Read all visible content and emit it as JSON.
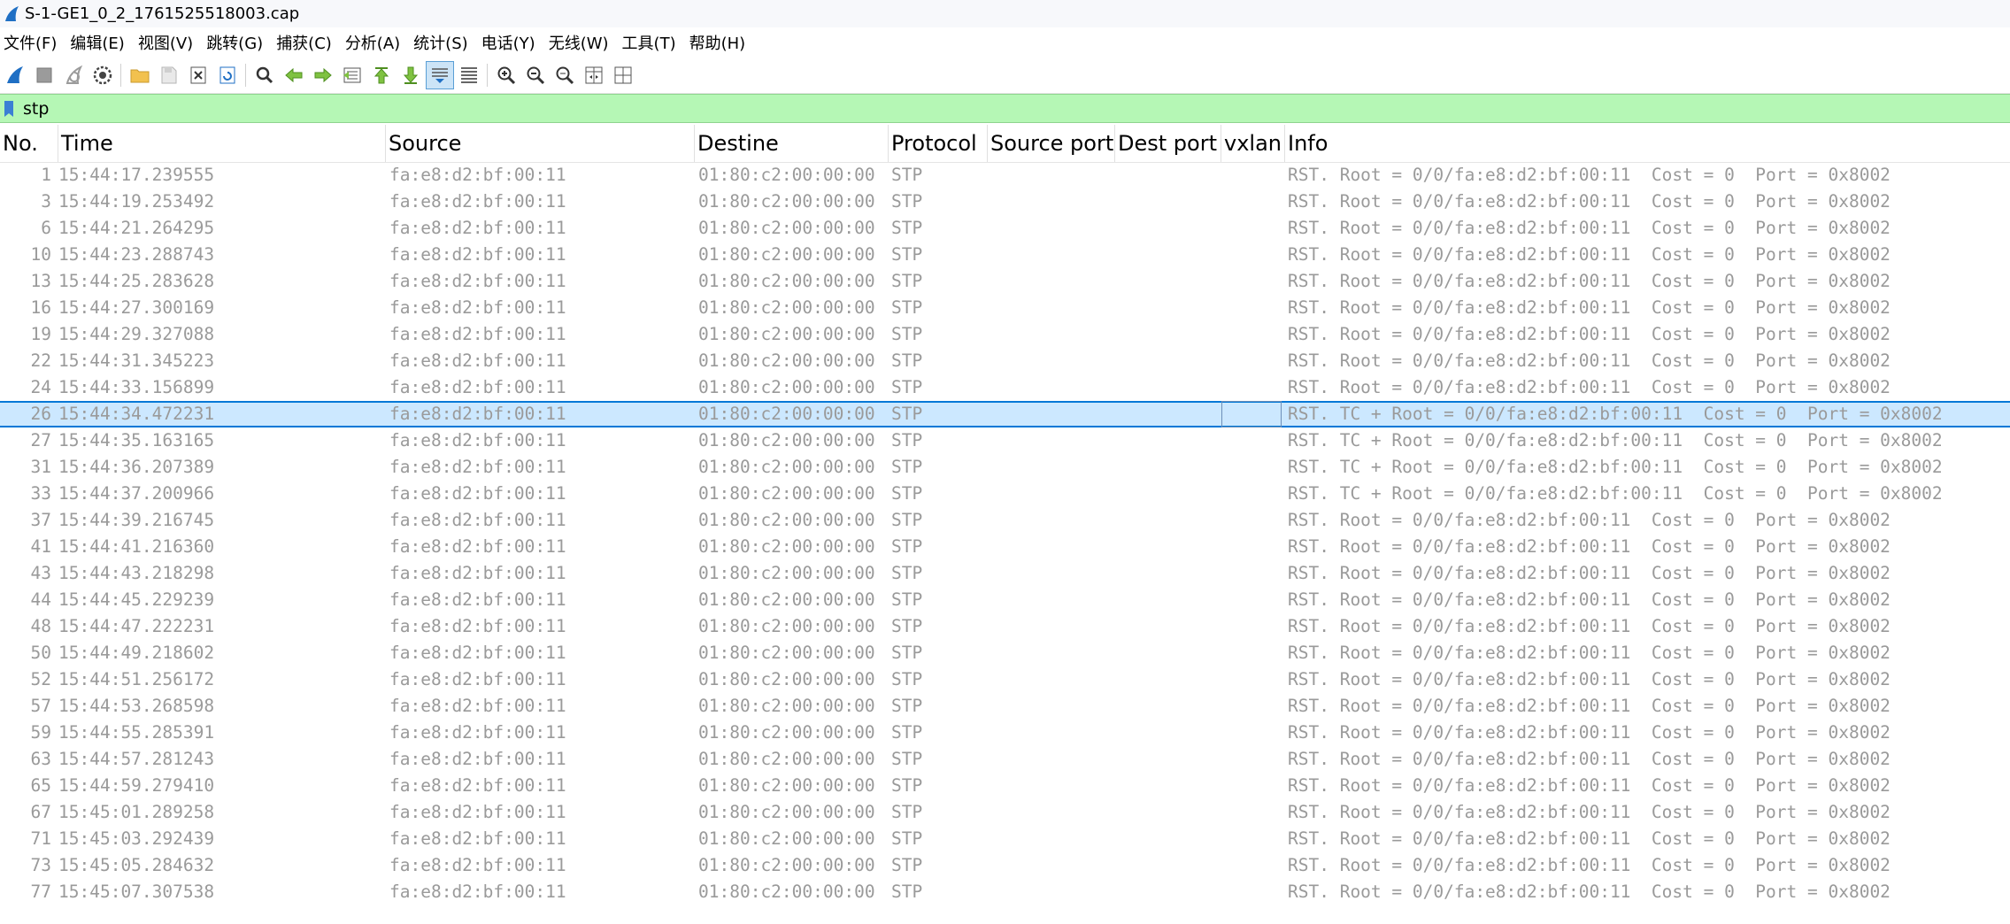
{
  "window": {
    "title": "S-1-GE1_0_2_1761525518003.cap"
  },
  "menu": [
    "文件(F)",
    "编辑(E)",
    "视图(V)",
    "跳转(G)",
    "捕获(C)",
    "分析(A)",
    "统计(S)",
    "电话(Y)",
    "无线(W)",
    "工具(T)",
    "帮助(H)"
  ],
  "toolbar": {
    "icons": [
      "start-capture-icon",
      "stop-capture-icon",
      "restart-capture-icon",
      "capture-options-icon",
      "open-file-icon",
      "save-file-icon",
      "close-file-icon",
      "reload-file-icon",
      "find-packet-icon",
      "go-back-icon",
      "go-forward-icon",
      "go-to-packet-icon",
      "go-to-first-icon",
      "go-to-last-icon",
      "autoscroll-icon",
      "colorize-icon",
      "zoom-in-icon",
      "zoom-out-icon",
      "normal-size-icon",
      "resize-columns-icon",
      "layout-icon"
    ]
  },
  "filter": {
    "value": "stp",
    "background_color": "#b5f7b5"
  },
  "columns": [
    "No.",
    "Time",
    "Source",
    "Destine",
    "Protocol",
    "Source port",
    "Dest port",
    "vxlan",
    "Info"
  ],
  "selected_row_index": 9,
  "packets": [
    {
      "no": "1",
      "time": "15:44:17.239555",
      "source": "fa:e8:d2:bf:00:11",
      "dest": "01:80:c2:00:00:00",
      "protocol": "STP",
      "source_port": "",
      "dest_port": "",
      "vxlan": "",
      "info": "RST. Root = 0/0/fa:e8:d2:bf:00:11  Cost = 0  Port = 0x8002"
    },
    {
      "no": "3",
      "time": "15:44:19.253492",
      "source": "fa:e8:d2:bf:00:11",
      "dest": "01:80:c2:00:00:00",
      "protocol": "STP",
      "source_port": "",
      "dest_port": "",
      "vxlan": "",
      "info": "RST. Root = 0/0/fa:e8:d2:bf:00:11  Cost = 0  Port = 0x8002"
    },
    {
      "no": "6",
      "time": "15:44:21.264295",
      "source": "fa:e8:d2:bf:00:11",
      "dest": "01:80:c2:00:00:00",
      "protocol": "STP",
      "source_port": "",
      "dest_port": "",
      "vxlan": "",
      "info": "RST. Root = 0/0/fa:e8:d2:bf:00:11  Cost = 0  Port = 0x8002"
    },
    {
      "no": "10",
      "time": "15:44:23.288743",
      "source": "fa:e8:d2:bf:00:11",
      "dest": "01:80:c2:00:00:00",
      "protocol": "STP",
      "source_port": "",
      "dest_port": "",
      "vxlan": "",
      "info": "RST. Root = 0/0/fa:e8:d2:bf:00:11  Cost = 0  Port = 0x8002"
    },
    {
      "no": "13",
      "time": "15:44:25.283628",
      "source": "fa:e8:d2:bf:00:11",
      "dest": "01:80:c2:00:00:00",
      "protocol": "STP",
      "source_port": "",
      "dest_port": "",
      "vxlan": "",
      "info": "RST. Root = 0/0/fa:e8:d2:bf:00:11  Cost = 0  Port = 0x8002"
    },
    {
      "no": "16",
      "time": "15:44:27.300169",
      "source": "fa:e8:d2:bf:00:11",
      "dest": "01:80:c2:00:00:00",
      "protocol": "STP",
      "source_port": "",
      "dest_port": "",
      "vxlan": "",
      "info": "RST. Root = 0/0/fa:e8:d2:bf:00:11  Cost = 0  Port = 0x8002"
    },
    {
      "no": "19",
      "time": "15:44:29.327088",
      "source": "fa:e8:d2:bf:00:11",
      "dest": "01:80:c2:00:00:00",
      "protocol": "STP",
      "source_port": "",
      "dest_port": "",
      "vxlan": "",
      "info": "RST. Root = 0/0/fa:e8:d2:bf:00:11  Cost = 0  Port = 0x8002"
    },
    {
      "no": "22",
      "time": "15:44:31.345223",
      "source": "fa:e8:d2:bf:00:11",
      "dest": "01:80:c2:00:00:00",
      "protocol": "STP",
      "source_port": "",
      "dest_port": "",
      "vxlan": "",
      "info": "RST. Root = 0/0/fa:e8:d2:bf:00:11  Cost = 0  Port = 0x8002"
    },
    {
      "no": "24",
      "time": "15:44:33.156899",
      "source": "fa:e8:d2:bf:00:11",
      "dest": "01:80:c2:00:00:00",
      "protocol": "STP",
      "source_port": "",
      "dest_port": "",
      "vxlan": "",
      "info": "RST. Root = 0/0/fa:e8:d2:bf:00:11  Cost = 0  Port = 0x8002"
    },
    {
      "no": "26",
      "time": "15:44:34.472231",
      "source": "fa:e8:d2:bf:00:11",
      "dest": "01:80:c2:00:00:00",
      "protocol": "STP",
      "source_port": "",
      "dest_port": "",
      "vxlan": "",
      "info": "RST. TC + Root = 0/0/fa:e8:d2:bf:00:11  Cost = 0  Port = 0x8002"
    },
    {
      "no": "27",
      "time": "15:44:35.163165",
      "source": "fa:e8:d2:bf:00:11",
      "dest": "01:80:c2:00:00:00",
      "protocol": "STP",
      "source_port": "",
      "dest_port": "",
      "vxlan": "",
      "info": "RST. TC + Root = 0/0/fa:e8:d2:bf:00:11  Cost = 0  Port = 0x8002"
    },
    {
      "no": "31",
      "time": "15:44:36.207389",
      "source": "fa:e8:d2:bf:00:11",
      "dest": "01:80:c2:00:00:00",
      "protocol": "STP",
      "source_port": "",
      "dest_port": "",
      "vxlan": "",
      "info": "RST. TC + Root = 0/0/fa:e8:d2:bf:00:11  Cost = 0  Port = 0x8002"
    },
    {
      "no": "33",
      "time": "15:44:37.200966",
      "source": "fa:e8:d2:bf:00:11",
      "dest": "01:80:c2:00:00:00",
      "protocol": "STP",
      "source_port": "",
      "dest_port": "",
      "vxlan": "",
      "info": "RST. TC + Root = 0/0/fa:e8:d2:bf:00:11  Cost = 0  Port = 0x8002"
    },
    {
      "no": "37",
      "time": "15:44:39.216745",
      "source": "fa:e8:d2:bf:00:11",
      "dest": "01:80:c2:00:00:00",
      "protocol": "STP",
      "source_port": "",
      "dest_port": "",
      "vxlan": "",
      "info": "RST. Root = 0/0/fa:e8:d2:bf:00:11  Cost = 0  Port = 0x8002"
    },
    {
      "no": "41",
      "time": "15:44:41.216360",
      "source": "fa:e8:d2:bf:00:11",
      "dest": "01:80:c2:00:00:00",
      "protocol": "STP",
      "source_port": "",
      "dest_port": "",
      "vxlan": "",
      "info": "RST. Root = 0/0/fa:e8:d2:bf:00:11  Cost = 0  Port = 0x8002"
    },
    {
      "no": "43",
      "time": "15:44:43.218298",
      "source": "fa:e8:d2:bf:00:11",
      "dest": "01:80:c2:00:00:00",
      "protocol": "STP",
      "source_port": "",
      "dest_port": "",
      "vxlan": "",
      "info": "RST. Root = 0/0/fa:e8:d2:bf:00:11  Cost = 0  Port = 0x8002"
    },
    {
      "no": "44",
      "time": "15:44:45.229239",
      "source": "fa:e8:d2:bf:00:11",
      "dest": "01:80:c2:00:00:00",
      "protocol": "STP",
      "source_port": "",
      "dest_port": "",
      "vxlan": "",
      "info": "RST. Root = 0/0/fa:e8:d2:bf:00:11  Cost = 0  Port = 0x8002"
    },
    {
      "no": "48",
      "time": "15:44:47.222231",
      "source": "fa:e8:d2:bf:00:11",
      "dest": "01:80:c2:00:00:00",
      "protocol": "STP",
      "source_port": "",
      "dest_port": "",
      "vxlan": "",
      "info": "RST. Root = 0/0/fa:e8:d2:bf:00:11  Cost = 0  Port = 0x8002"
    },
    {
      "no": "50",
      "time": "15:44:49.218602",
      "source": "fa:e8:d2:bf:00:11",
      "dest": "01:80:c2:00:00:00",
      "protocol": "STP",
      "source_port": "",
      "dest_port": "",
      "vxlan": "",
      "info": "RST. Root = 0/0/fa:e8:d2:bf:00:11  Cost = 0  Port = 0x8002"
    },
    {
      "no": "52",
      "time": "15:44:51.256172",
      "source": "fa:e8:d2:bf:00:11",
      "dest": "01:80:c2:00:00:00",
      "protocol": "STP",
      "source_port": "",
      "dest_port": "",
      "vxlan": "",
      "info": "RST. Root = 0/0/fa:e8:d2:bf:00:11  Cost = 0  Port = 0x8002"
    },
    {
      "no": "57",
      "time": "15:44:53.268598",
      "source": "fa:e8:d2:bf:00:11",
      "dest": "01:80:c2:00:00:00",
      "protocol": "STP",
      "source_port": "",
      "dest_port": "",
      "vxlan": "",
      "info": "RST. Root = 0/0/fa:e8:d2:bf:00:11  Cost = 0  Port = 0x8002"
    },
    {
      "no": "59",
      "time": "15:44:55.285391",
      "source": "fa:e8:d2:bf:00:11",
      "dest": "01:80:c2:00:00:00",
      "protocol": "STP",
      "source_port": "",
      "dest_port": "",
      "vxlan": "",
      "info": "RST. Root = 0/0/fa:e8:d2:bf:00:11  Cost = 0  Port = 0x8002"
    },
    {
      "no": "63",
      "time": "15:44:57.281243",
      "source": "fa:e8:d2:bf:00:11",
      "dest": "01:80:c2:00:00:00",
      "protocol": "STP",
      "source_port": "",
      "dest_port": "",
      "vxlan": "",
      "info": "RST. Root = 0/0/fa:e8:d2:bf:00:11  Cost = 0  Port = 0x8002"
    },
    {
      "no": "65",
      "time": "15:44:59.279410",
      "source": "fa:e8:d2:bf:00:11",
      "dest": "01:80:c2:00:00:00",
      "protocol": "STP",
      "source_port": "",
      "dest_port": "",
      "vxlan": "",
      "info": "RST. Root = 0/0/fa:e8:d2:bf:00:11  Cost = 0  Port = 0x8002"
    },
    {
      "no": "67",
      "time": "15:45:01.289258",
      "source": "fa:e8:d2:bf:00:11",
      "dest": "01:80:c2:00:00:00",
      "protocol": "STP",
      "source_port": "",
      "dest_port": "",
      "vxlan": "",
      "info": "RST. Root = 0/0/fa:e8:d2:bf:00:11  Cost = 0  Port = 0x8002"
    },
    {
      "no": "71",
      "time": "15:45:03.292439",
      "source": "fa:e8:d2:bf:00:11",
      "dest": "01:80:c2:00:00:00",
      "protocol": "STP",
      "source_port": "",
      "dest_port": "",
      "vxlan": "",
      "info": "RST. Root = 0/0/fa:e8:d2:bf:00:11  Cost = 0  Port = 0x8002"
    },
    {
      "no": "73",
      "time": "15:45:05.284632",
      "source": "fa:e8:d2:bf:00:11",
      "dest": "01:80:c2:00:00:00",
      "protocol": "STP",
      "source_port": "",
      "dest_port": "",
      "vxlan": "",
      "info": "RST. Root = 0/0/fa:e8:d2:bf:00:11  Cost = 0  Port = 0x8002"
    },
    {
      "no": "77",
      "time": "15:45:07.307538",
      "source": "fa:e8:d2:bf:00:11",
      "dest": "01:80:c2:00:00:00",
      "protocol": "STP",
      "source_port": "",
      "dest_port": "",
      "vxlan": "",
      "info": "RST. Root = 0/0/fa:e8:d2:bf:00:11  Cost = 0  Port = 0x8002"
    }
  ]
}
